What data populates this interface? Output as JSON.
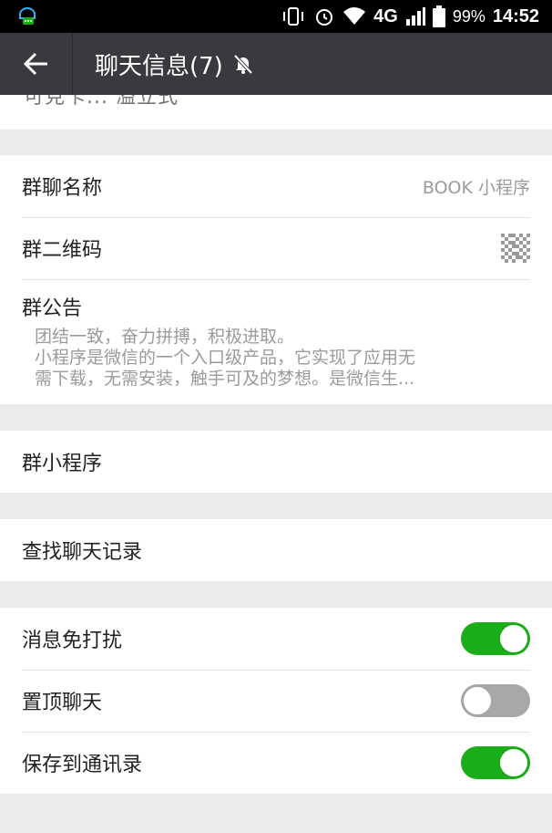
{
  "status_bar": {
    "battery": "99%",
    "time": "14:52",
    "network": "4G"
  },
  "header": {
    "title": "聊天信息(7)"
  },
  "top_strip": {
    "cut_text": "可見卡...  溢立式"
  },
  "group_info": {
    "name_label": "群聊名称",
    "name_value": "BOOK 小程序",
    "qr_label": "群二维码",
    "notice_label": "群公告",
    "notice_text": "团结一致，奋力拼搏，积极进取。\n小程序是微信的一个入口级产品，它实现了应用无需下载，无需安装，触手可及的梦想。是微信生..."
  },
  "mini_program": {
    "label": "群小程序"
  },
  "search_history": {
    "label": "查找聊天记录"
  },
  "settings": {
    "mute_label": "消息免打扰",
    "mute_on": true,
    "pin_label": "置顶聊天",
    "pin_on": false,
    "save_label": "保存到通讯录",
    "save_on": true
  },
  "colors": {
    "appbar": "#393a3f",
    "toggle_on": "#1aad19",
    "toggle_off": "#a7a7a7"
  },
  "icons": {
    "back": "arrow-left-icon",
    "muted": "bell-off-icon",
    "qr": "qr-code-icon"
  }
}
